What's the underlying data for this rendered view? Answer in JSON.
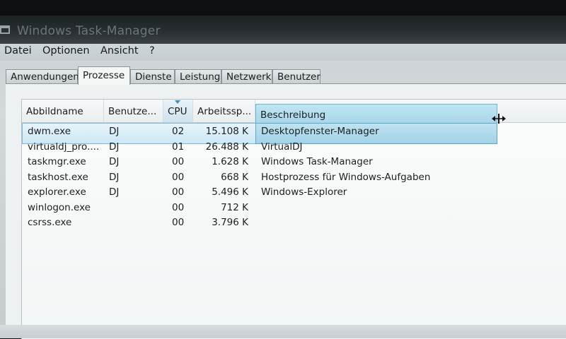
{
  "window": {
    "title": "Windows Task-Manager"
  },
  "menu": [
    "Datei",
    "Optionen",
    "Ansicht",
    "?"
  ],
  "tabs": [
    "Anwendungen",
    "Prozesse",
    "Dienste",
    "Leistung",
    "Netzwerk",
    "Benutzer"
  ],
  "active_tab": "Prozesse",
  "columns": [
    "Abbildname",
    "Benutze...",
    "CPU",
    "Arbeitssp...",
    "Beschreibung"
  ],
  "sorted_column": "CPU",
  "processes": [
    {
      "name": "dwm.exe",
      "user": "DJ",
      "cpu": "02",
      "mem": "15.108 K",
      "desc": "Desktopfenster-Manager"
    },
    {
      "name": "virtualdj_pro....",
      "user": "DJ",
      "cpu": "01",
      "mem": "26.488 K",
      "desc": "VirtualDJ"
    },
    {
      "name": "taskmgr.exe",
      "user": "DJ",
      "cpu": "00",
      "mem": "1.628 K",
      "desc": "Windows Task-Manager"
    },
    {
      "name": "taskhost.exe",
      "user": "DJ",
      "cpu": "00",
      "mem": "668 K",
      "desc": "Hostprozess für Windows-Aufgaben"
    },
    {
      "name": "explorer.exe",
      "user": "DJ",
      "cpu": "00",
      "mem": "5.496 K",
      "desc": "Windows-Explorer"
    },
    {
      "name": "winlogon.exe",
      "user": "",
      "cpu": "00",
      "mem": "712 K",
      "desc": ""
    },
    {
      "name": "csrss.exe",
      "user": "",
      "cpu": "00",
      "mem": "3.796 K",
      "desc": ""
    }
  ],
  "selected_process": "dwm.exe"
}
